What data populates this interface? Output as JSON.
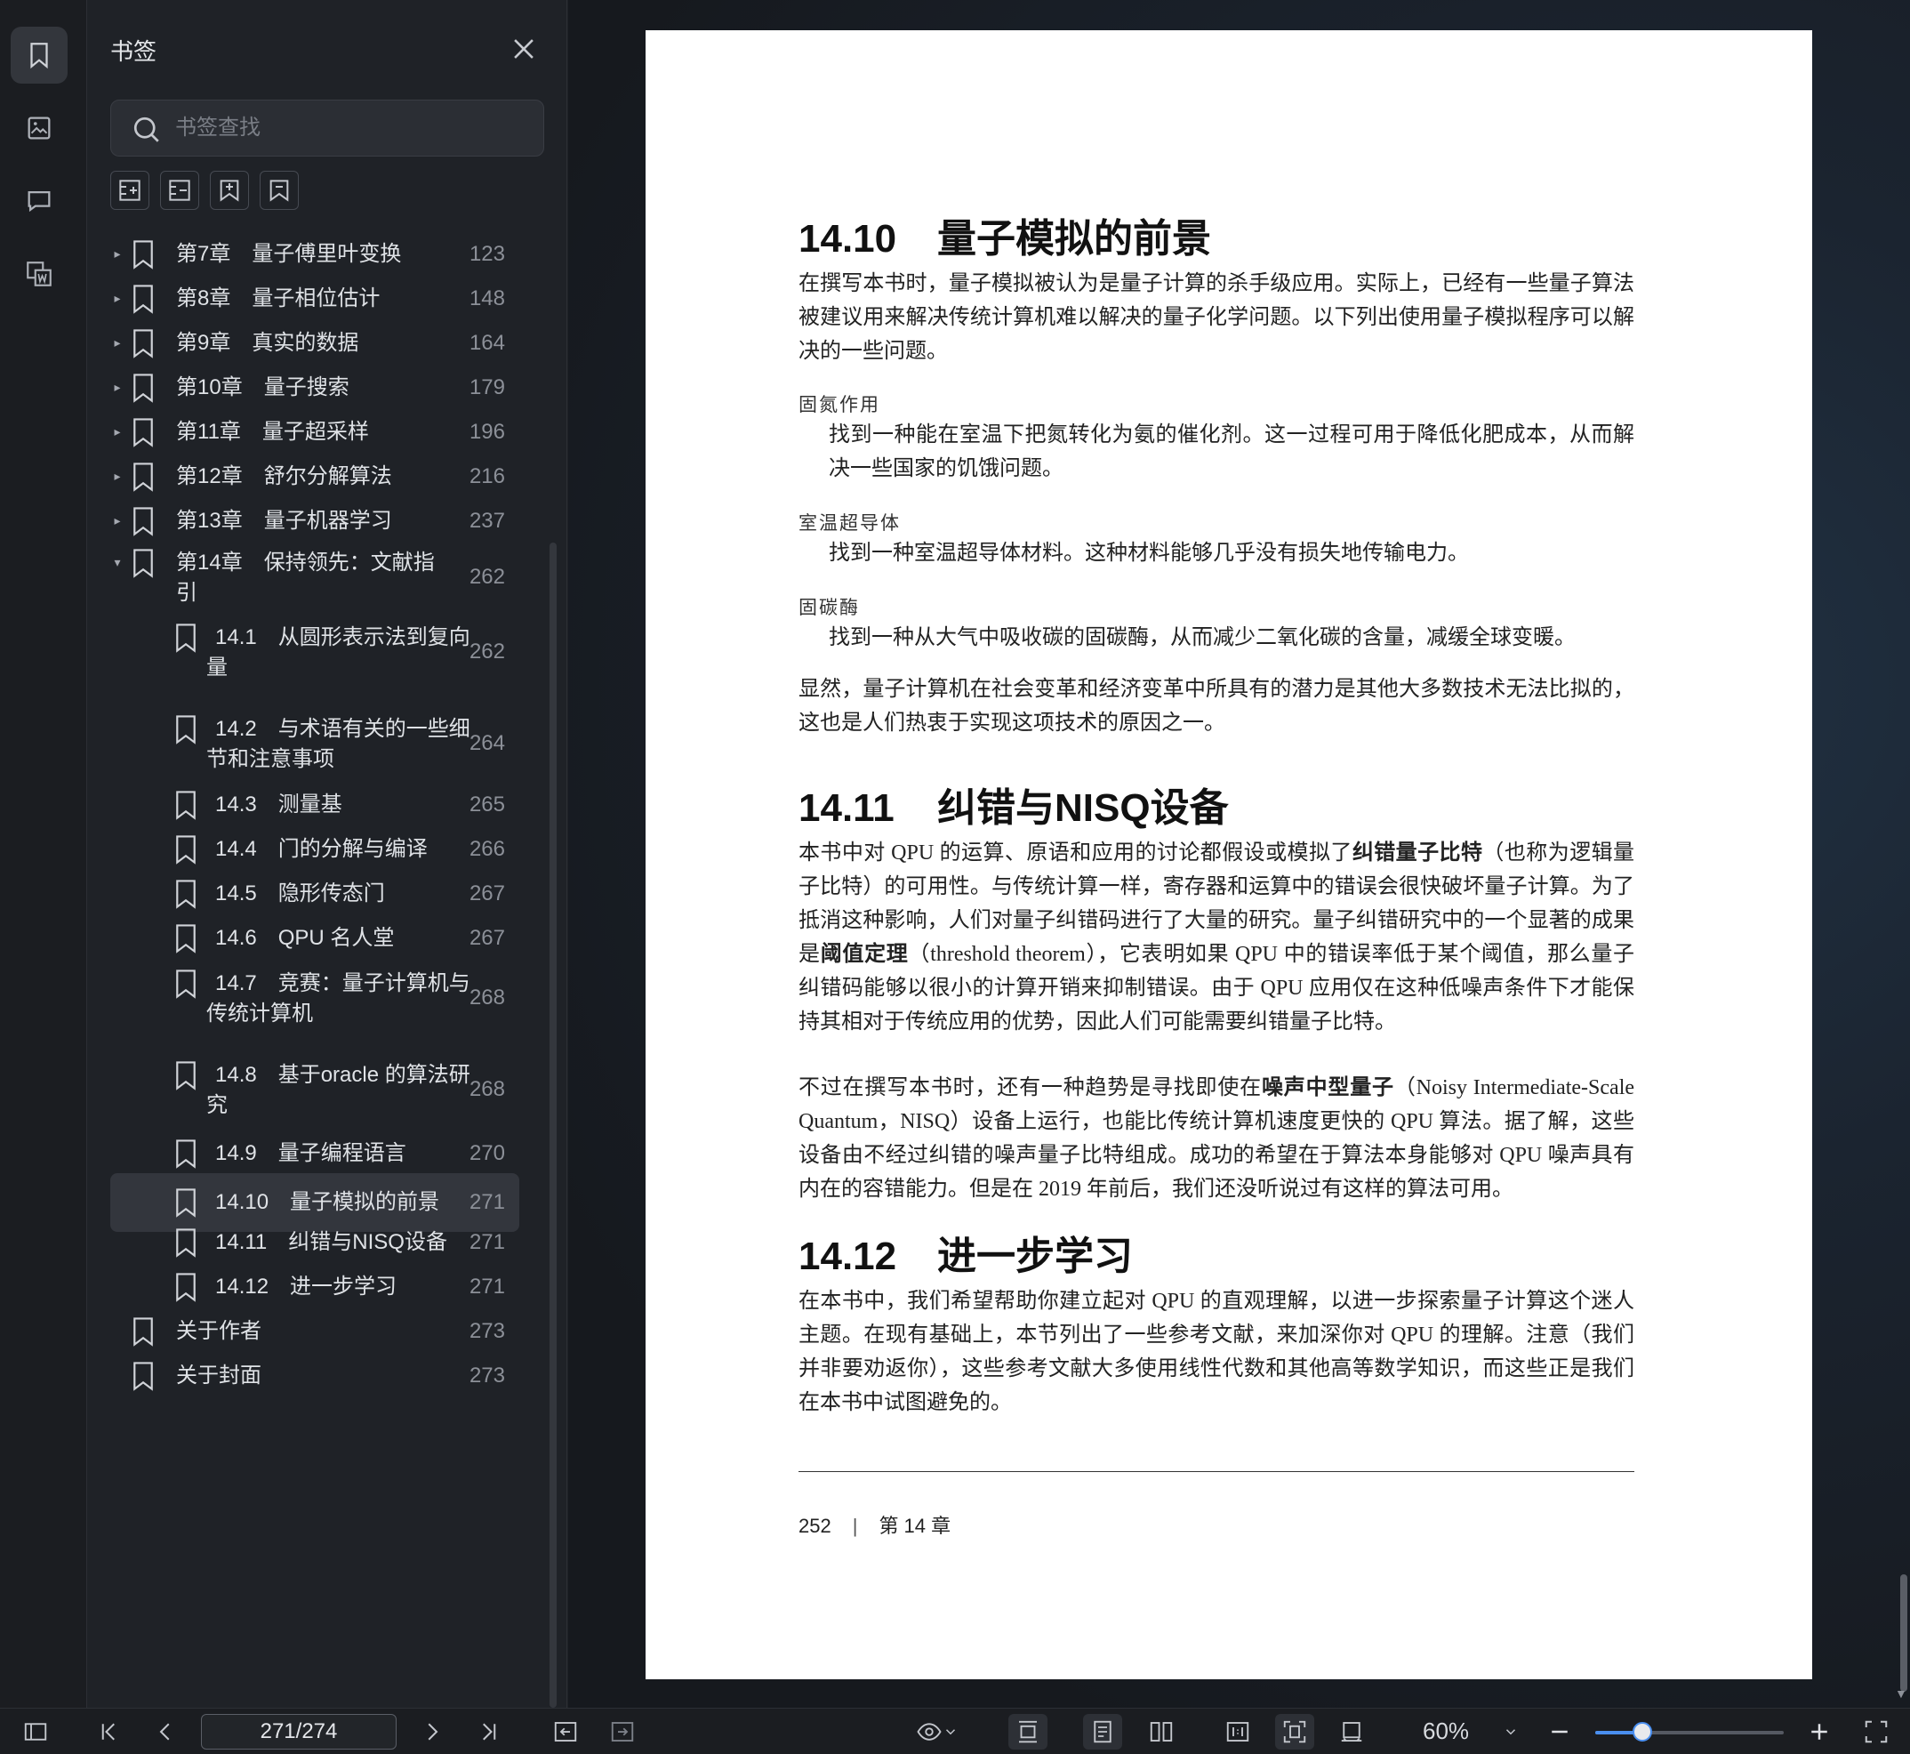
{
  "panel": {
    "title": "书签",
    "search_placeholder": "书签查找"
  },
  "bookmarks": [
    {
      "label": "第7章　量子傅里叶变换",
      "page": "123",
      "level": 0,
      "caret": "▸"
    },
    {
      "label": "第8章　量子相位估计",
      "page": "148",
      "level": 0,
      "caret": "▸"
    },
    {
      "label": "第9章　真实的数据",
      "page": "164",
      "level": 0,
      "caret": "▸"
    },
    {
      "label": "第10章　量子搜索",
      "page": "179",
      "level": 0,
      "caret": "▸"
    },
    {
      "label": "第11章　量子超采样",
      "page": "196",
      "level": 0,
      "caret": "▸"
    },
    {
      "label": "第12章　舒尔分解算法",
      "page": "216",
      "level": 0,
      "caret": "▸"
    },
    {
      "label": "第13章　量子机器学习",
      "page": "237",
      "level": 0,
      "caret": "▸"
    },
    {
      "label": "第14章　保持领先：文献指引",
      "page": "262",
      "level": 0,
      "caret": "▾"
    },
    {
      "label": "14.1　从圆形表示法到复向量",
      "page": "262",
      "level": 1,
      "caret": ""
    },
    {
      "label": "14.2　与术语有关的一些细节和注意事项",
      "page": "264",
      "level": 1,
      "caret": ""
    },
    {
      "label": "14.3　测量基",
      "page": "265",
      "level": 1,
      "caret": ""
    },
    {
      "label": "14.4　门的分解与编译",
      "page": "266",
      "level": 1,
      "caret": ""
    },
    {
      "label": "14.5　隐形传态门",
      "page": "267",
      "level": 1,
      "caret": ""
    },
    {
      "label": "14.6　QPU 名人堂",
      "page": "267",
      "level": 1,
      "caret": ""
    },
    {
      "label": "14.7　竞赛：量子计算机与传统计算机",
      "page": "268",
      "level": 1,
      "caret": ""
    },
    {
      "label": "14.8　基于oracle 的算法研究",
      "page": "268",
      "level": 1,
      "caret": ""
    },
    {
      "label": "14.9　量子编程语言",
      "page": "270",
      "level": 1,
      "caret": ""
    },
    {
      "label": "14.10　量子模拟的前景",
      "page": "271",
      "level": 1,
      "caret": "",
      "active": true
    },
    {
      "label": "14.11　纠错与NISQ设备",
      "page": "271",
      "level": 1,
      "caret": ""
    },
    {
      "label": "14.12　进一步学习",
      "page": "271",
      "level": 1,
      "caret": ""
    },
    {
      "label": "关于作者",
      "page": "273",
      "level": 0,
      "caret": ""
    },
    {
      "label": "关于封面",
      "page": "273",
      "level": 0,
      "caret": ""
    }
  ],
  "doc": {
    "h1_num": "14.10",
    "h1_title": "量子模拟的前景",
    "p1": "在撰写本书时，量子模拟被认为是量子计算的杀手级应用。实际上，已经有一些量子算法被建议用来解决传统计算机难以解决的量子化学问题。以下列出使用量子模拟程序可以解决的一些问题。",
    "t1": "固氮作用",
    "d1": "找到一种能在室温下把氮转化为氨的催化剂。这一过程可用于降低化肥成本，从而解决一些国家的饥饿问题。",
    "t2": "室温超导体",
    "d2": "找到一种室温超导体材料。这种材料能够几乎没有损失地传输电力。",
    "t3": "固碳酶",
    "d3": "找到一种从大气中吸收碳的固碳酶，从而减少二氧化碳的含量，减缓全球变暖。",
    "p2": "显然，量子计算机在社会变革和经济变革中所具有的潜力是其他大多数技术无法比拟的，这也是人们热衷于实现这项技术的原因之一。",
    "h2_num": "14.11",
    "h2_title": "纠错与NISQ设备",
    "p3_a": "本书中对 QPU 的运算、原语和应用的讨论都假设或模拟了",
    "p3_b1": "纠错量子比特",
    "p3_c": "（也称为逻辑量子比特）的可用性。与传统计算一样，寄存器和运算中的错误会很快破坏量子计算。为了抵消这种影响，人们对量子纠错码进行了大量的研究。量子纠错研究中的一个显著的成果是",
    "p3_b2": "阈值定理",
    "p3_d": "（threshold theorem），它表明如果 QPU 中的错误率低于某个阈值，那么量子纠错码能够以很小的计算开销来抑制错误。由于 QPU 应用仅在这种低噪声条件下才能保持其相对于传统应用的优势，因此人们可能需要纠错量子比特。",
    "p4_a": "不过在撰写本书时，还有一种趋势是寻找即使在",
    "p4_b": "噪声中型量子",
    "p4_c": "（Noisy Intermediate-Scale Quantum，NISQ）设备上运行，也能比传统计算机速度更快的 QPU 算法。据了解，这些设备由不经过纠错的噪声量子比特组成。成功的希望在于算法本身能够对 QPU 噪声具有内在的容错能力。但是在 2019 年前后，我们还没听说过有这样的算法可用。",
    "h3_num": "14.12",
    "h3_title": "进一步学习",
    "p5": "在本书中，我们希望帮助你建立起对 QPU 的直观理解，以进一步探索量子计算这个迷人主题。在现有基础上，本节列出了一些参考文献，来加深你对 QPU 的理解。注意（我们并非要劝返你），这些参考文献大多使用线性代数和其他高等数学知识，而这些正是我们在本书中试图避免的。",
    "footer_page": "252",
    "footer_chapter": "第 14 章"
  },
  "toolbar": {
    "page_indicator": "271/274",
    "zoom": "60%",
    "zoom_level": 0.25
  },
  "colors": {
    "accent": "#4a8ff0",
    "panel_bg": "#1f2227",
    "active_row": "#33363d"
  }
}
